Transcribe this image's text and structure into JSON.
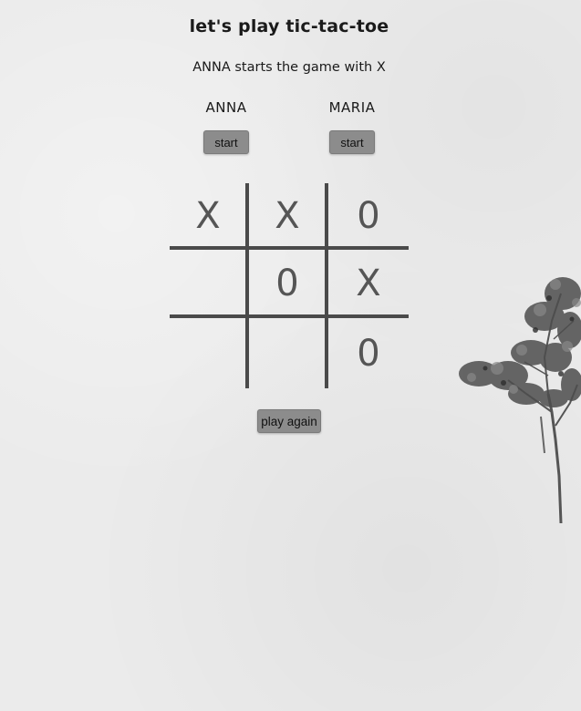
{
  "game": {
    "title": "let's play tic-tac-toe",
    "status": "ANNA starts the game with X"
  },
  "players": [
    {
      "name": "ANNA",
      "button_label": "start"
    },
    {
      "name": "MARIA",
      "button_label": "start"
    }
  ],
  "board": {
    "cells": [
      "X",
      "X",
      "0",
      "",
      "0",
      "X",
      "",
      "",
      "0"
    ]
  },
  "controls": {
    "play_again_label": "play again"
  },
  "colors": {
    "background": "#ebebeb",
    "button": "#8c8c8c",
    "grid": "#4a4a4a",
    "mark": "#555555"
  },
  "decorations": {
    "tree_icon": "tree-icon"
  }
}
